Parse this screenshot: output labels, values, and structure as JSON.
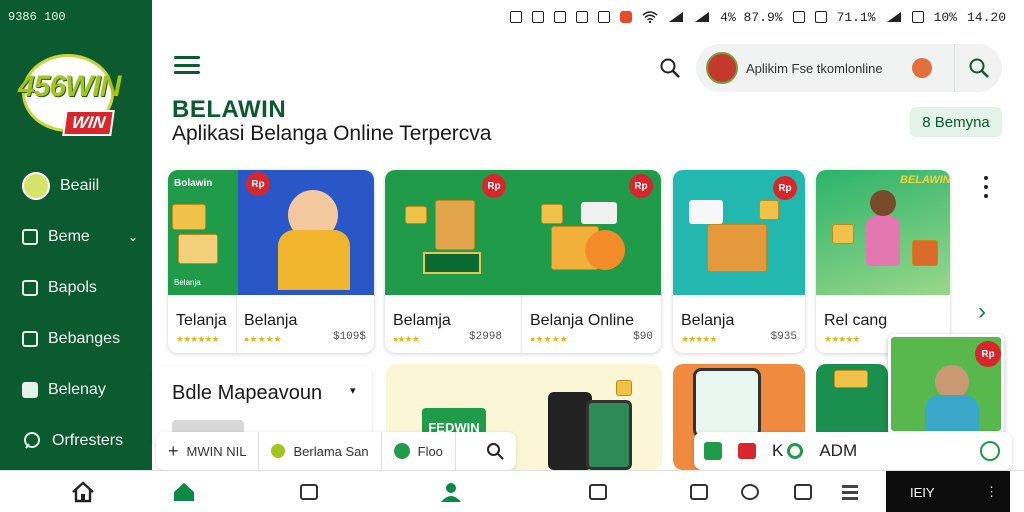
{
  "status_bar": {
    "left_time": "9386 100",
    "battery_percent": "4% 87.9%",
    "percent_2": "71.1%",
    "percent_3": "10%",
    "clock": "14.20"
  },
  "sidebar": {
    "logo_number": "456WIN",
    "logo_badge": "WIN",
    "items": [
      {
        "label": "Beaiil",
        "icon": "avatar-icon"
      },
      {
        "label": "Beme",
        "icon": "wallet-icon",
        "has_chevron": true
      },
      {
        "label": "Bapols",
        "icon": "document-icon"
      },
      {
        "label": "Bebanges",
        "icon": "card-icon"
      },
      {
        "label": "Belenay",
        "icon": "square-icon"
      },
      {
        "label": "Orfresters",
        "icon": "chat-icon"
      }
    ]
  },
  "header": {
    "account_name": "Aplikim Fse tkomlonline",
    "title": "BELAWIN",
    "subtitle": "Aplikasi Belanga Online Terpercva",
    "action_button": "8 Bemyna"
  },
  "products": [
    {
      "title": "Telanja",
      "price": "",
      "stars": "★★★★★★",
      "tag": "Rp"
    },
    {
      "title": "Belanja",
      "price": "$109$",
      "stars": "●★★★★"
    },
    {
      "title": "Belamja",
      "price": "$2998",
      "stars": "●★★★"
    },
    {
      "title": "Belanja Online",
      "price": "$90",
      "stars": "●★★★★",
      "tag": "Rp"
    },
    {
      "title": "Belanja",
      "price": "$935",
      "stars": "★★★★★",
      "tag": "Rp"
    },
    {
      "title": "Rel cang",
      "price": "",
      "stars": "★★★★★"
    }
  ],
  "product_image_labels": {
    "card1_top": "Bolawin",
    "card1_bottom": "Belanja",
    "card4_sign": "BELAWIN"
  },
  "section": {
    "title": "Bdle Mapeavoun"
  },
  "promos": [
    {
      "label": "FEDWIN"
    }
  ],
  "toolbar": {
    "item1": "MWIN NIL",
    "item2": "Berlama San",
    "item3": "Floo"
  },
  "toolbar2": {
    "text1": "K",
    "text2": "ADM"
  },
  "bottom_nav": {
    "dark_label": "IEIY"
  },
  "colors": {
    "brand_green": "#0c5a2f",
    "accent_green": "#0c8a45",
    "red": "#d8262c",
    "star": "#f2b21a"
  }
}
